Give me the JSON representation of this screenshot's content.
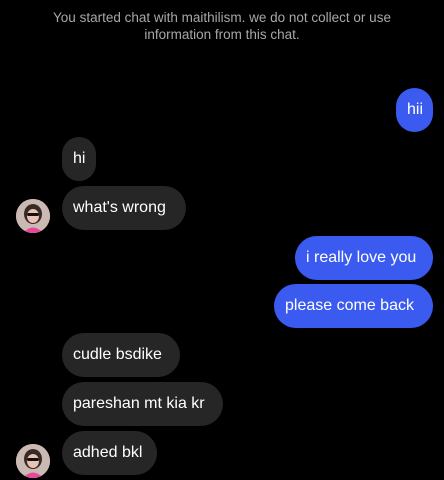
{
  "chat": {
    "notice_line1": "You started chat with maithilism. we do not collect or use",
    "notice_line2": "information from this chat.",
    "messages": [
      {
        "text": "hii",
        "direction": "outgoing"
      },
      {
        "text": "hi",
        "direction": "incoming"
      },
      {
        "text": "what's wrong",
        "direction": "incoming"
      },
      {
        "text": "i really love you",
        "direction": "outgoing"
      },
      {
        "text": "please come back",
        "direction": "outgoing"
      },
      {
        "text": "cudle bsdike",
        "direction": "incoming"
      },
      {
        "text": "pareshan mt kia kr",
        "direction": "incoming"
      },
      {
        "text": "adhed bkl",
        "direction": "incoming"
      }
    ],
    "avatar_icon": "contact-avatar-icon"
  },
  "colors": {
    "background": "#000000",
    "incoming_bubble": "#262626",
    "outgoing_bubble": "#3b5bf0",
    "notice_text": "#a8a8a8"
  }
}
